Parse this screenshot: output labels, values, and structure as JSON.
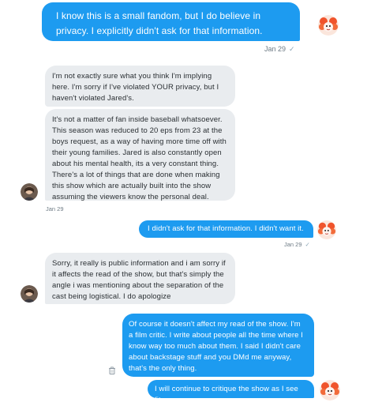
{
  "messages": [
    {
      "who": "me",
      "text": "I know this is a small fandom, but I do believe in privacy. I explicitly didn't ask for that information."
    },
    {
      "who": "them",
      "text": "I'm not exactly sure what you think I'm implying here. I'm sorry if I've violated YOUR privacy, but I haven't violated Jared's."
    },
    {
      "who": "them",
      "text": "It's not a matter of fan inside baseball whatsoever. This season was reduced to 20 eps from 23 at the boys request, as a way of having more time off with their young families. Jared is also constantly open about his mental health, its a very constant thing. There's a lot of things that are done when making this show which are actually built into the show assuming the viewers know the personal deal."
    },
    {
      "who": "me",
      "text": "I didn't ask for that information. I didn't want it."
    },
    {
      "who": "them",
      "text": "Sorry, it really is public information and i am sorry if it affects the read of the show, but that's simply the angle i was mentioning about the separation of the cast being logistical. I do apologize"
    },
    {
      "who": "me",
      "text": "Of course it doesn't affect my read of the show. I'm a film critic. I write about people all the time where I know way too much about them. I said I didn't care about backstage stuff and you DMd me anyway, that's the only thing."
    },
    {
      "who": "me",
      "text": "I will continue to critique the show as I see fit."
    }
  ],
  "timestamps": {
    "t1": "Jan 29",
    "t2": "Jan 29",
    "t3": "Jan 29"
  },
  "read_check": "✓",
  "colors": {
    "sent": "#1d9bf0",
    "received": "#e9ecef"
  },
  "icons": {
    "delete": "trash-icon",
    "avatar_me": "avatar-icon",
    "avatar_them": "avatar-icon"
  }
}
